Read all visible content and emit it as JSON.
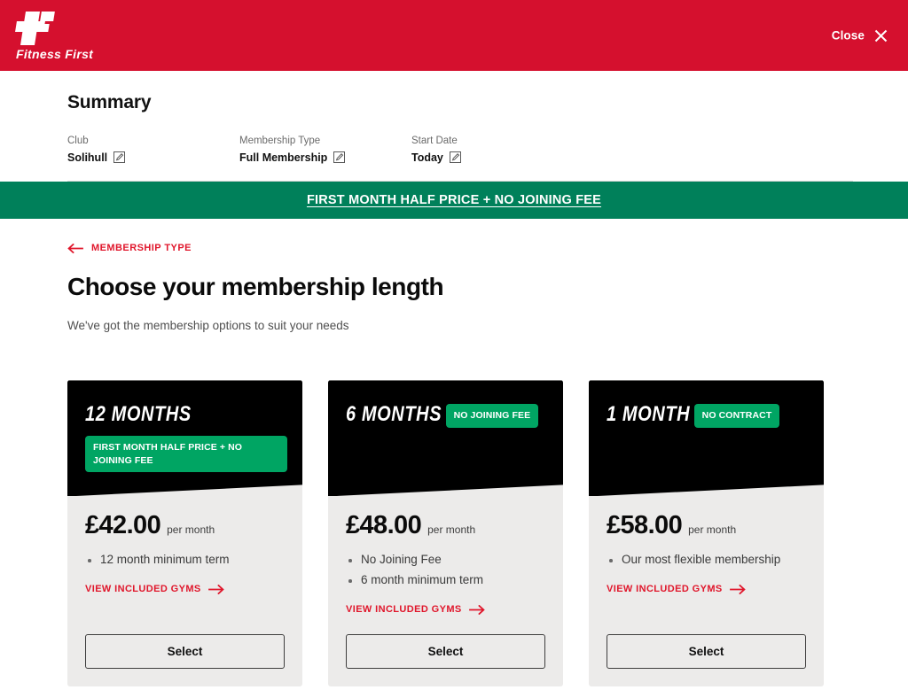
{
  "header": {
    "brand_name": "Fitness First",
    "close_label": "Close",
    "close_icon": "close-icon"
  },
  "summary": {
    "title": "Summary",
    "items": [
      {
        "label": "Club",
        "value": "Solihull",
        "edit_icon": "edit-icon"
      },
      {
        "label": "Membership Type",
        "value": "Full Membership",
        "edit_icon": "edit-icon"
      },
      {
        "label": "Start Date",
        "value": "Today",
        "edit_icon": "edit-icon"
      }
    ]
  },
  "promo_banner": {
    "text": "FIRST MONTH HALF PRICE + NO JOINING FEE",
    "background_color": "#00805A"
  },
  "main": {
    "back_link": {
      "label": "MEMBERSHIP TYPE",
      "icon": "arrow-left-icon"
    },
    "title": "Choose your membership length",
    "subtitle": "We've got the membership options to suit your needs",
    "cards": [
      {
        "term": "12 MONTHS",
        "badge": "FIRST MONTH HALF PRICE + NO JOINING FEE",
        "price": "£42.00",
        "period": "per month",
        "features": [
          "12 month minimum term"
        ],
        "gyms_link": "VIEW INCLUDED GYMS",
        "select_label": "Select"
      },
      {
        "term": "6 MONTHS",
        "badge": "NO JOINING FEE",
        "price": "£48.00",
        "period": "per month",
        "features": [
          "No Joining Fee",
          "6 month minimum term"
        ],
        "gyms_link": "VIEW INCLUDED GYMS",
        "select_label": "Select"
      },
      {
        "term": "1 MONTH",
        "badge": "NO CONTRACT",
        "price": "£58.00",
        "period": "per month",
        "features": [
          "Our most flexible membership"
        ],
        "gyms_link": "VIEW INCLUDED GYMS",
        "select_label": "Select"
      }
    ]
  },
  "colors": {
    "brand_red": "#D5102E",
    "promo_green": "#00805A",
    "badge_green": "#00A563",
    "link_red": "#E0162B",
    "card_bg": "#ECEBEA",
    "card_head": "#000000"
  }
}
